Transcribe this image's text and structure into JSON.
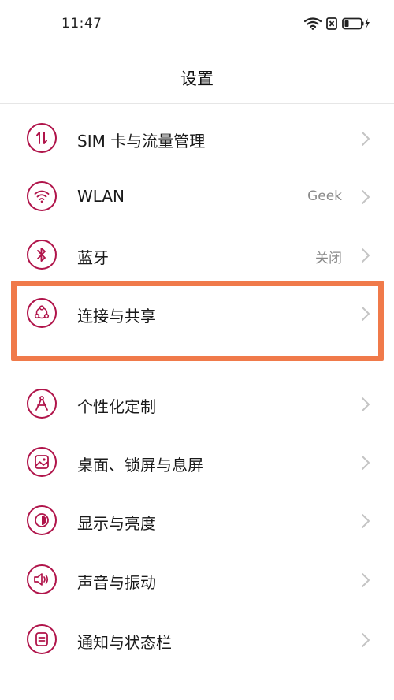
{
  "status_bar": {
    "time": "11:47",
    "icons": [
      "wifi-icon",
      "sim-off-icon",
      "battery-charging-icon"
    ]
  },
  "header": {
    "title": "设置"
  },
  "settings": {
    "items": [
      {
        "label": "SIM 卡与流量管理",
        "value": "",
        "icon": "sim-data-icon"
      },
      {
        "label": "WLAN",
        "value": "Geek",
        "icon": "wifi-icon"
      },
      {
        "label": "蓝牙",
        "value": "关闭",
        "icon": "bluetooth-icon"
      },
      {
        "label": "连接与共享",
        "value": "",
        "icon": "share-icon",
        "highlighted": true
      },
      {
        "label": "个性化定制",
        "value": "",
        "icon": "personalize-icon"
      },
      {
        "label": "桌面、锁屏与息屏",
        "value": "",
        "icon": "wallpaper-icon"
      },
      {
        "label": "显示与亮度",
        "value": "",
        "icon": "brightness-icon"
      },
      {
        "label": "声音与振动",
        "value": "",
        "icon": "sound-icon"
      },
      {
        "label": "通知与状态栏",
        "value": "",
        "icon": "notification-icon"
      }
    ]
  },
  "colors": {
    "accent": "#b0144a",
    "highlight": "#f07a4a",
    "chevron": "#c4c4c4",
    "value_text": "#8a8a8a"
  }
}
